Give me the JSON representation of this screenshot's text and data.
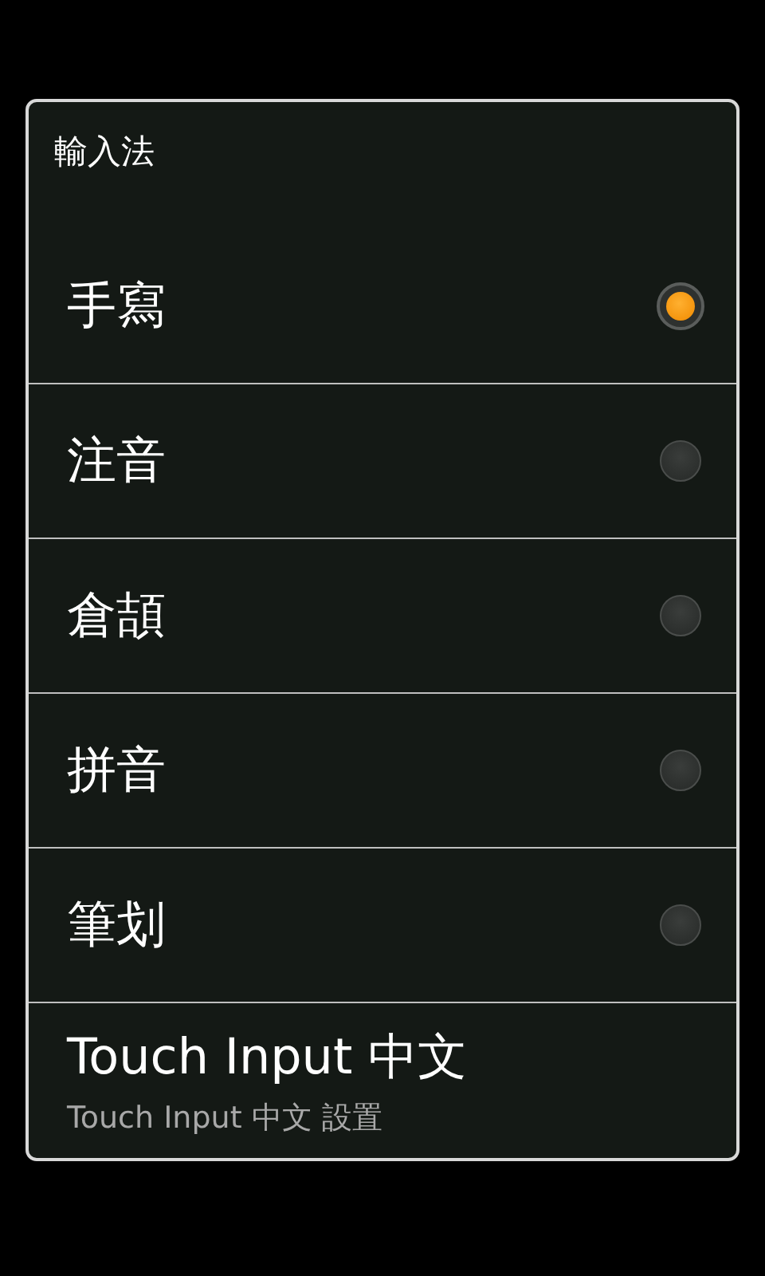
{
  "dialog": {
    "title": "輸入法",
    "options": [
      {
        "kind": "radio",
        "label": "手寫",
        "selected": true
      },
      {
        "kind": "radio",
        "label": "注音",
        "selected": false
      },
      {
        "kind": "radio",
        "label": "倉頡",
        "selected": false
      },
      {
        "kind": "radio",
        "label": "拼音",
        "selected": false
      },
      {
        "kind": "radio",
        "label": "筆划",
        "selected": false
      },
      {
        "kind": "setting",
        "label": "Touch Input 中文",
        "summary": "Touch Input 中文 設置"
      }
    ]
  }
}
